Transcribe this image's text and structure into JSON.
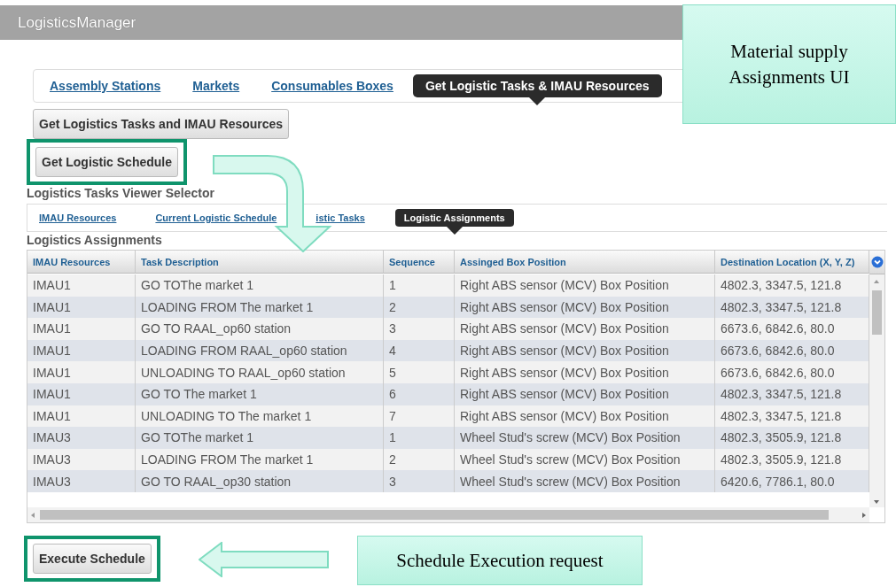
{
  "window": {
    "title": "LogisticsManager"
  },
  "main_tabs": [
    {
      "label": "Assembly Stations",
      "selected": false
    },
    {
      "label": "Markets",
      "selected": false
    },
    {
      "label": "Consumables Boxes",
      "selected": false
    },
    {
      "label": "Get Logistic Tasks & IMAU Resources",
      "selected": true
    }
  ],
  "buttons": [
    {
      "label": "Get Logistics Tasks and IMAU Resources",
      "highlighted": false
    },
    {
      "label": "Get Logistic Schedule",
      "highlighted": true
    }
  ],
  "viewer_selector": {
    "title": "Logistics Tasks Viewer Selector",
    "tabs": [
      {
        "label": "IMAU Resources",
        "selected": false
      },
      {
        "label": "Current Logistic Schedule",
        "selected": false
      },
      {
        "label": "istic Tasks",
        "selected": false
      },
      {
        "label": "Logistic Assignments",
        "selected": true
      }
    ]
  },
  "assignments": {
    "title": "Logistics Assignments",
    "columns": [
      "IMAU Resources",
      "Task Description",
      "Sequence",
      "Assinged Box Position",
      "Destination Location (X, Y, Z)"
    ],
    "rows": [
      [
        "IMAU1",
        "GO TOThe market 1",
        "1",
        "Right ABS sensor (MCV) Box Position",
        "4802.3, 3347.5, 121.8"
      ],
      [
        "IMAU1",
        "LOADING FROM The market 1",
        "2",
        "Right ABS sensor (MCV) Box Position",
        "4802.3, 3347.5, 121.8"
      ],
      [
        "IMAU1",
        "GO TO RAAL_op60 station",
        "3",
        "Right ABS sensor (MCV) Box Position",
        "6673.6, 6842.6, 80.0"
      ],
      [
        "IMAU1",
        "LOADING FROM RAAL_op60 station",
        "4",
        "Right ABS sensor (MCV) Box Position",
        "6673.6, 6842.6, 80.0"
      ],
      [
        "IMAU1",
        "UNLOADING TO RAAL_op60 station",
        "5",
        "Right ABS sensor (MCV) Box Position",
        "6673.6, 6842.6, 80.0"
      ],
      [
        "IMAU1",
        "GO TO The market 1",
        "6",
        "Right ABS sensor (MCV) Box Position",
        "4802.3, 3347.5, 121.8"
      ],
      [
        "IMAU1",
        "UNLOADING TO The market 1",
        "7",
        "Right ABS sensor (MCV) Box Position",
        "4802.3, 3347.5, 121.8"
      ],
      [
        "IMAU3",
        "GO TOThe market 1",
        "1",
        "Wheel Stud's screw (MCV) Box Position",
        "4802.3, 3505.9, 121.8"
      ],
      [
        "IMAU3",
        "LOADING FROM The market 1",
        "2",
        "Wheel Stud's screw (MCV) Box Position",
        "4802.3, 3505.9, 121.8"
      ],
      [
        "IMAU3",
        "GO TO RAAL_op30 station",
        "3",
        "Wheel Stud's screw (MCV) Box Position",
        "6420.6, 7786.1, 80.0"
      ]
    ]
  },
  "execute_button": {
    "label": "Execute Schedule",
    "highlighted": true
  },
  "callouts": [
    {
      "text": "Material supply Assignments UI"
    },
    {
      "text": "Schedule Execution request"
    }
  ]
}
